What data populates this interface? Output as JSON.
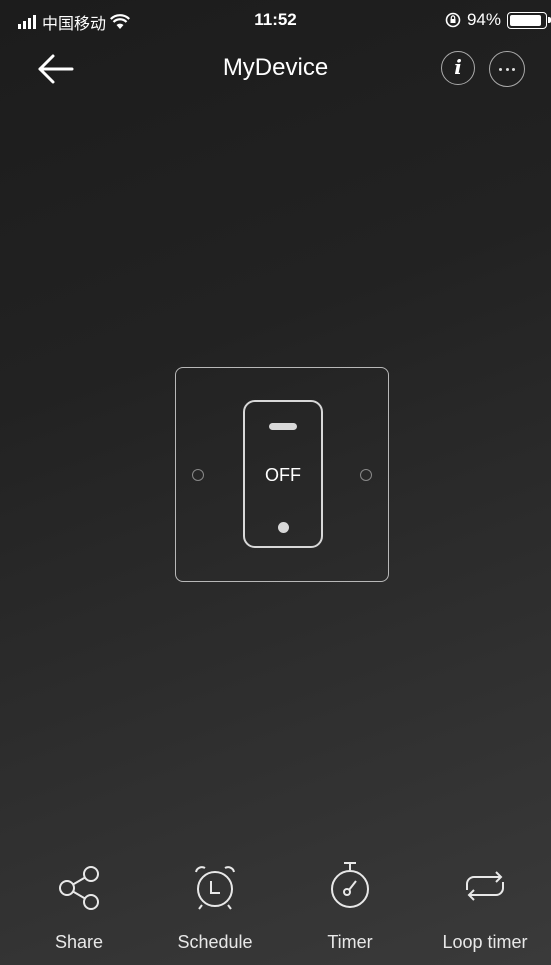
{
  "status_bar": {
    "carrier": "中国移动",
    "time": "11:52",
    "battery_percent": "94%",
    "battery_level": 0.94,
    "icons": [
      "signal-icon",
      "wifi-icon",
      "orientation-lock-icon",
      "battery-icon"
    ]
  },
  "nav": {
    "title": "MyDevice",
    "info_label": "i",
    "icons": [
      "back-arrow-icon",
      "info-icon",
      "more-icon"
    ]
  },
  "device": {
    "state": "OFF"
  },
  "toolbar": {
    "items": [
      {
        "label": "Share",
        "icon": "share-icon"
      },
      {
        "label": "Schedule",
        "icon": "alarm-clock-icon"
      },
      {
        "label": "Timer",
        "icon": "stopwatch-icon"
      },
      {
        "label": "Loop timer",
        "icon": "loop-icon"
      }
    ]
  },
  "colors": {
    "background_top": "#1c1c1c",
    "background_bottom": "#3a3a3a",
    "foreground": "#ffffff",
    "outline": "#b8b8b8"
  }
}
